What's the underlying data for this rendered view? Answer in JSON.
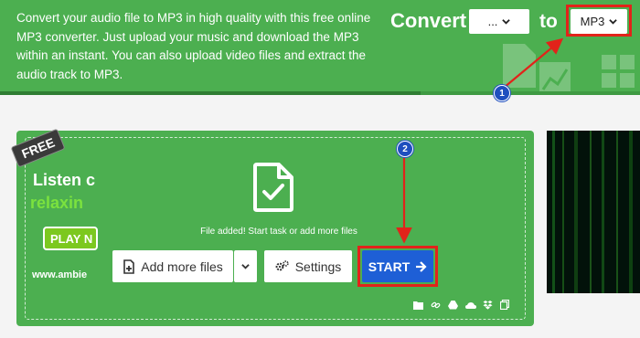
{
  "header": {
    "intro": "Convert your audio file to MP3 in high quality with this free online MP3 converter. Just upload your music and download the MP3 within an instant. You can also upload video files and extract the audio track to MP3.",
    "convert_label": "Convert",
    "from_format": "...",
    "to_label": "to",
    "to_format": "MP3"
  },
  "converter": {
    "status_text": "File added! Start task or add more files",
    "add_files_label": "Add more files",
    "settings_label": "Settings",
    "start_label": "START",
    "source_icons": [
      "folder-icon",
      "link-icon",
      "google-drive-icon",
      "onedrive-icon",
      "dropbox-icon",
      "clipboard-icon"
    ]
  },
  "annotations": {
    "step_1": "1",
    "step_2": "2"
  },
  "ad": {
    "badge": "FREE",
    "line1": "Listen c",
    "line2": "relaxin",
    "play": "PLAY N",
    "url": "www.ambie"
  },
  "colors": {
    "brand_green": "#4caf50",
    "start_blue": "#1e5fd6",
    "highlight_red": "#e2231a"
  }
}
